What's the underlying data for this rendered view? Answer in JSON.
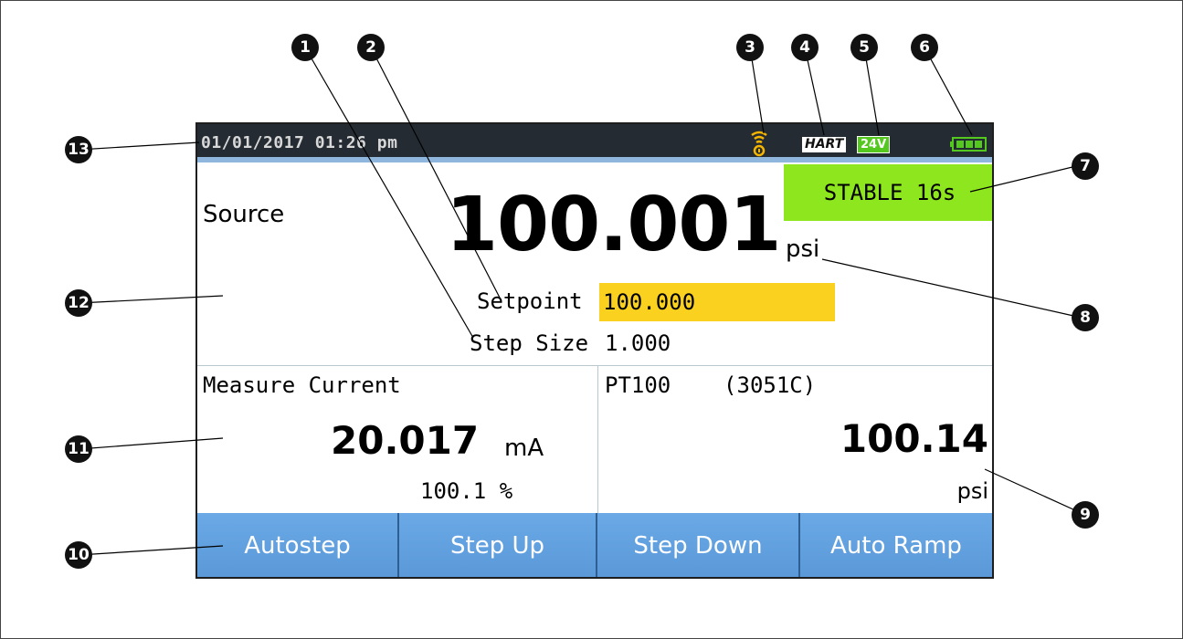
{
  "status_bar": {
    "datetime": "01/01/2017 01:26 pm",
    "hart_label": "HART",
    "voltage_label": "24V",
    "wireless_icon": "wireless-icon",
    "battery_icon": "battery-icon"
  },
  "source": {
    "label": "Source",
    "stable_text": "STABLE 16s",
    "value": "100.001",
    "unit": "psi",
    "setpoint_label": "Setpoint",
    "setpoint_value": "100.000",
    "step_size_label": "Step Size",
    "step_size_value": "1.000"
  },
  "measure_current": {
    "label": "Measure Current",
    "value": "20.017",
    "unit": "mA",
    "percent": "100.1 %"
  },
  "pt100": {
    "label": "PT100    (3051C)",
    "value": "100.14",
    "unit": "psi"
  },
  "softkeys": [
    "Autostep",
    "Step Up",
    "Step Down",
    "Auto Ramp"
  ],
  "callouts": [
    "1",
    "2",
    "3",
    "4",
    "5",
    "6",
    "7",
    "8",
    "9",
    "10",
    "11",
    "12",
    "13"
  ],
  "colors": {
    "status_bar": "#242b33",
    "stable_bg": "#8ee61f",
    "setpoint_bg": "#f9d11e",
    "softkey_bg": "#5a98d8",
    "voltage_bg": "#55c81f"
  }
}
